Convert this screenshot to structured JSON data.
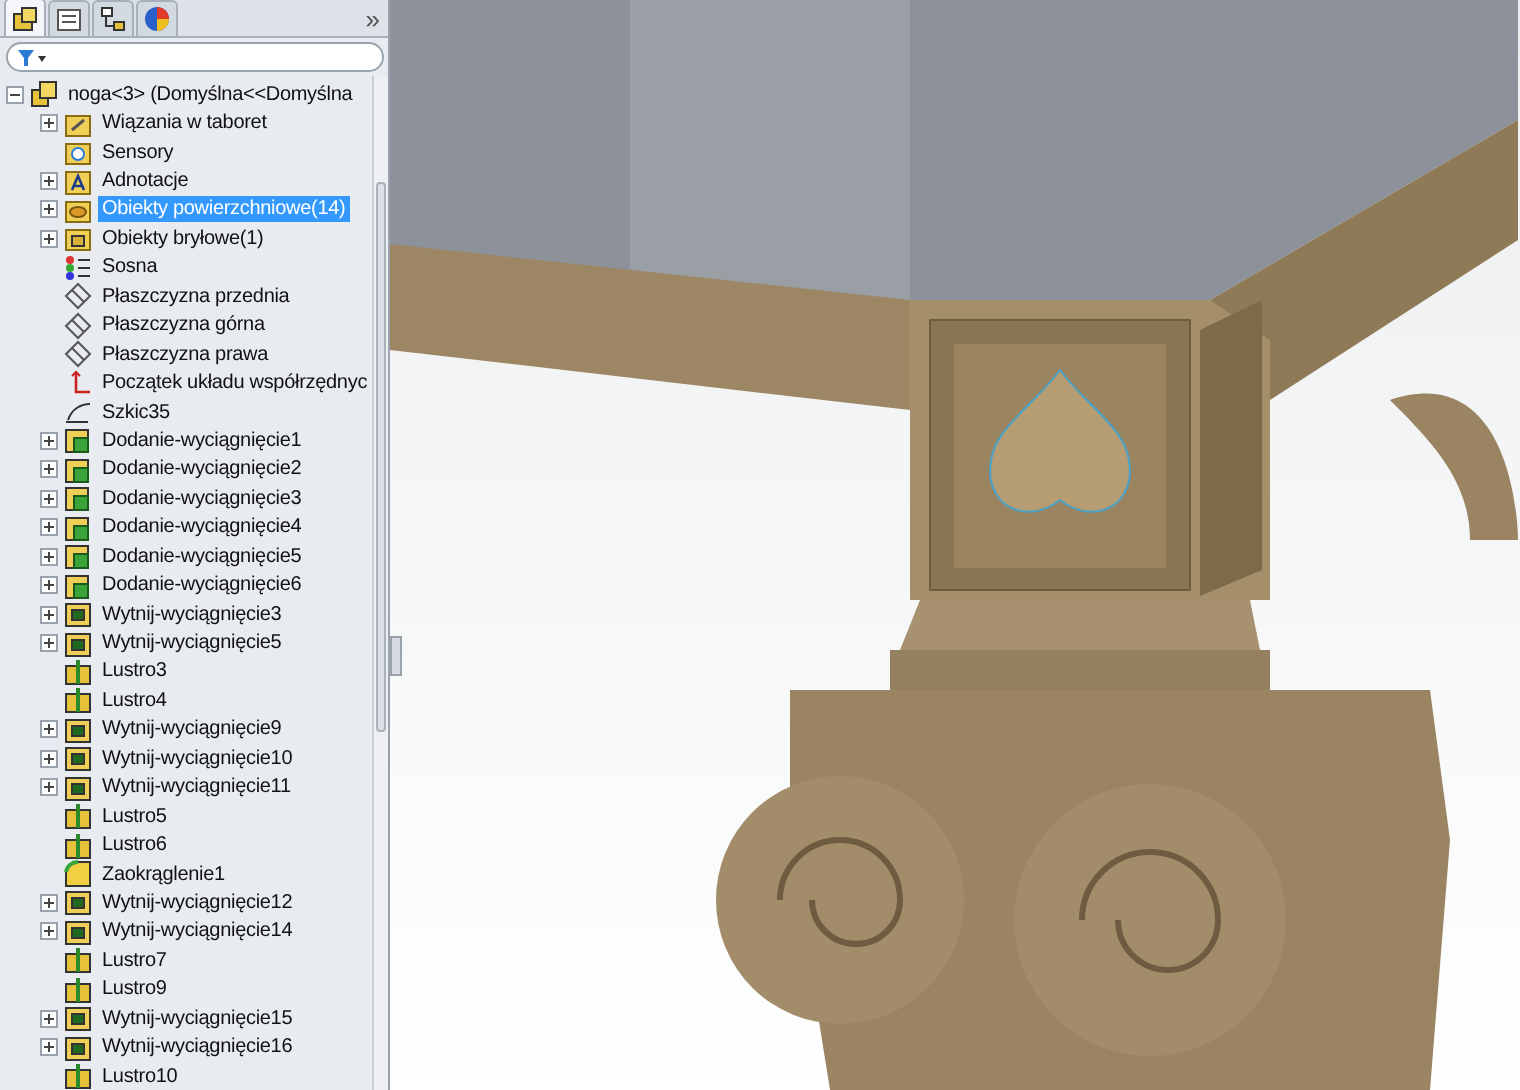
{
  "panel_tabs": [
    {
      "kind": "feature",
      "selected": true
    },
    {
      "kind": "property",
      "selected": false
    },
    {
      "kind": "config",
      "selected": false
    },
    {
      "kind": "appearance",
      "selected": false
    }
  ],
  "more_tabs": "»",
  "filter": {
    "kind": "filter"
  },
  "tree": {
    "root": {
      "label": "noga<3> (Domyślna<<Domyślna",
      "expanded": true
    },
    "items": [
      {
        "label": "Wiązania w taboret",
        "kind": "mates",
        "has_children": true,
        "selected": false
      },
      {
        "label": "Sensory",
        "kind": "sensor",
        "has_children": false,
        "selected": false
      },
      {
        "label": "Adnotacje",
        "kind": "annotation",
        "has_children": true,
        "selected": false
      },
      {
        "label": "Obiekty powierzchniowe(14)",
        "kind": "surface",
        "has_children": true,
        "selected": true
      },
      {
        "label": "Obiekty bryłowe(1)",
        "kind": "solid",
        "has_children": true,
        "selected": false
      },
      {
        "label": "Sosna",
        "kind": "material",
        "has_children": false,
        "selected": false
      },
      {
        "label": "Płaszczyzna przednia",
        "kind": "plane",
        "has_children": false,
        "selected": false
      },
      {
        "label": "Płaszczyzna górna",
        "kind": "plane",
        "has_children": false,
        "selected": false
      },
      {
        "label": "Płaszczyzna prawa",
        "kind": "plane",
        "has_children": false,
        "selected": false
      },
      {
        "label": "Początek układu współrzędnyc",
        "kind": "origin",
        "has_children": false,
        "selected": false
      },
      {
        "label": "Szkic35",
        "kind": "sketch",
        "has_children": false,
        "selected": false
      },
      {
        "label": "Dodanie-wyciągnięcie1",
        "kind": "boss",
        "has_children": true,
        "selected": false
      },
      {
        "label": "Dodanie-wyciągnięcie2",
        "kind": "boss",
        "has_children": true,
        "selected": false
      },
      {
        "label": "Dodanie-wyciągnięcie3",
        "kind": "boss",
        "has_children": true,
        "selected": false
      },
      {
        "label": "Dodanie-wyciągnięcie4",
        "kind": "boss",
        "has_children": true,
        "selected": false
      },
      {
        "label": "Dodanie-wyciągnięcie5",
        "kind": "boss",
        "has_children": true,
        "selected": false
      },
      {
        "label": "Dodanie-wyciągnięcie6",
        "kind": "boss",
        "has_children": true,
        "selected": false
      },
      {
        "label": "Wytnij-wyciągnięcie3",
        "kind": "cut",
        "has_children": true,
        "selected": false
      },
      {
        "label": "Wytnij-wyciągnięcie5",
        "kind": "cut",
        "has_children": true,
        "selected": false
      },
      {
        "label": "Lustro3",
        "kind": "mirror",
        "has_children": false,
        "selected": false
      },
      {
        "label": "Lustro4",
        "kind": "mirror",
        "has_children": false,
        "selected": false
      },
      {
        "label": "Wytnij-wyciągnięcie9",
        "kind": "cut",
        "has_children": true,
        "selected": false
      },
      {
        "label": "Wytnij-wyciągnięcie10",
        "kind": "cut",
        "has_children": true,
        "selected": false
      },
      {
        "label": "Wytnij-wyciągnięcie11",
        "kind": "cut",
        "has_children": true,
        "selected": false
      },
      {
        "label": "Lustro5",
        "kind": "mirror",
        "has_children": false,
        "selected": false
      },
      {
        "label": "Lustro6",
        "kind": "mirror",
        "has_children": false,
        "selected": false
      },
      {
        "label": "Zaokrąglenie1",
        "kind": "fillet",
        "has_children": false,
        "selected": false
      },
      {
        "label": "Wytnij-wyciągnięcie12",
        "kind": "cut",
        "has_children": true,
        "selected": false
      },
      {
        "label": "Wytnij-wyciągnięcie14",
        "kind": "cut",
        "has_children": true,
        "selected": false
      },
      {
        "label": "Lustro7",
        "kind": "mirror",
        "has_children": false,
        "selected": false
      },
      {
        "label": "Lustro9",
        "kind": "mirror",
        "has_children": false,
        "selected": false
      },
      {
        "label": "Wytnij-wyciągnięcie15",
        "kind": "cut",
        "has_children": true,
        "selected": false
      },
      {
        "label": "Wytnij-wyciągnięcie16",
        "kind": "cut",
        "has_children": true,
        "selected": false
      },
      {
        "label": "Lustro10",
        "kind": "mirror",
        "has_children": false,
        "selected": false
      }
    ]
  }
}
